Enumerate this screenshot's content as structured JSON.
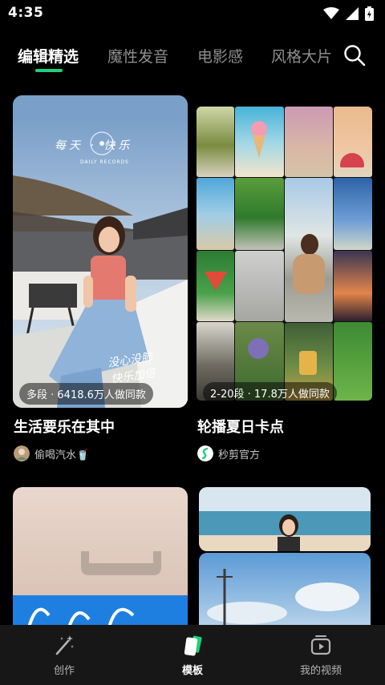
{
  "status_bar": {
    "time": "4:35"
  },
  "tabs": [
    {
      "label": "编辑精选",
      "active": true
    },
    {
      "label": "魔性发音"
    },
    {
      "label": "电影感"
    },
    {
      "label": "风格大片"
    }
  ],
  "feed": {
    "cards": [
      {
        "badge": "多段 · 6418.6万人做同款",
        "title": "生活要乐在其中",
        "author": "偷喝汽水🥤",
        "overlay_texts": {
          "headline": "每天 · 快乐",
          "brand": "DAILY RECORDS",
          "caption_1": "没心没肺",
          "caption_2": "快乐加倍"
        }
      },
      {
        "badge": "2-20段 · 17.8万人做同款",
        "title": "轮播夏日卡点",
        "author": "秒剪官方"
      }
    ]
  },
  "bottom_nav": [
    {
      "label": "创作",
      "icon": "magic-wand-icon"
    },
    {
      "label": "模板",
      "icon": "template-icon",
      "active": true
    },
    {
      "label": "我的视频",
      "icon": "my-videos-icon"
    }
  ],
  "colors": {
    "accent": "#1fcf7a",
    "background": "#000000",
    "nav_bg": "#171717"
  }
}
